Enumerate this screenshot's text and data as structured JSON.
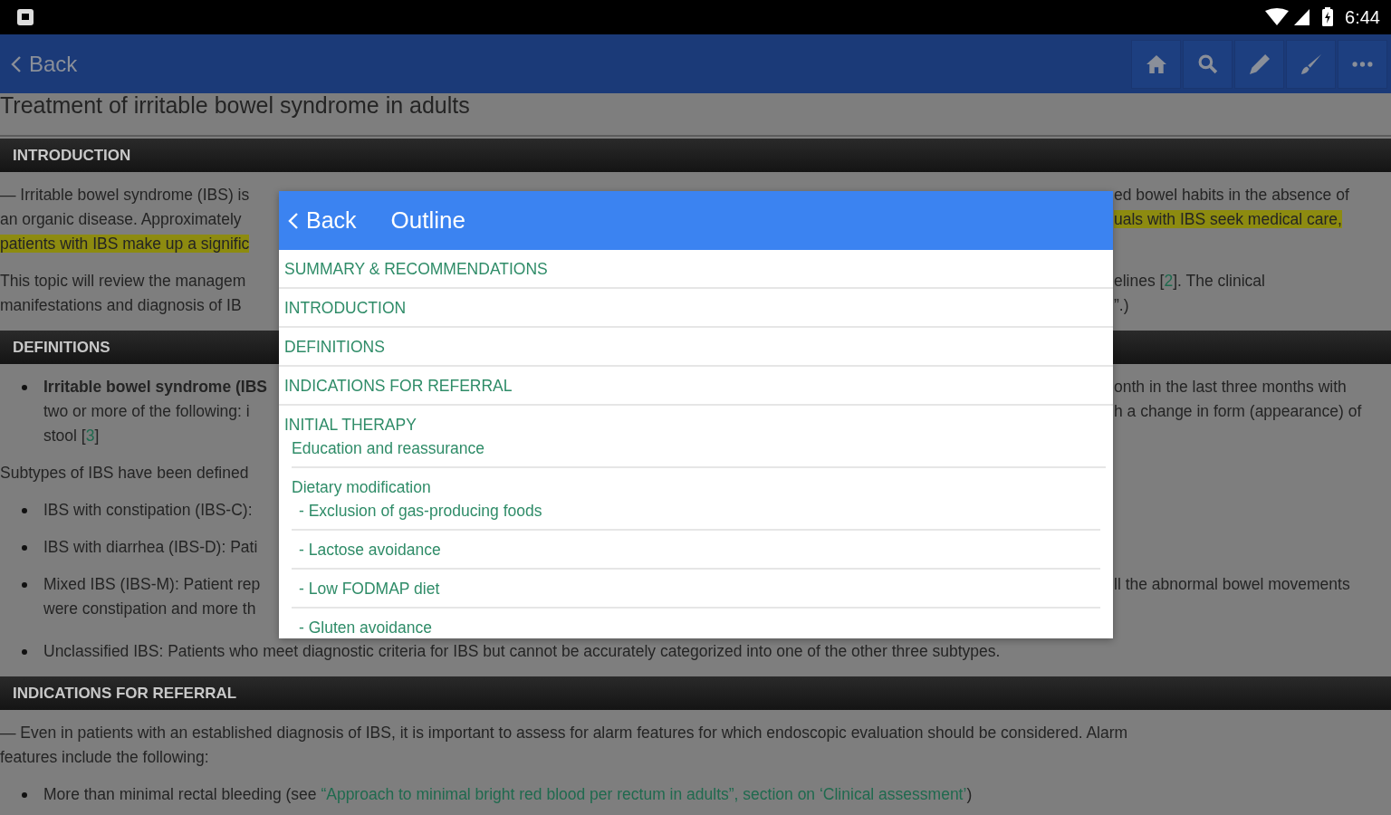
{
  "status_bar": {
    "time": "6:44"
  },
  "app_bar": {
    "back": "Back"
  },
  "title": "Treatment of irritable bowel syndrome in adults",
  "sections": [
    {
      "heading": "INTRODUCTION",
      "lines": [
        {
          "kind": "text",
          "left": [
            {
              "text": "— Irritable bowel syndrome (IBS) is",
              "kind": "plain"
            }
          ],
          "right": [
            {
              "text": "ed bowel habits in the absence of",
              "kind": "plain"
            }
          ]
        },
        {
          "kind": "text",
          "left": [
            {
              "text": "an organic disease. Approximately",
              "kind": "plain"
            }
          ],
          "right": [
            {
              "text": "uals with IBS seek medical care,",
              "kind": "highlight"
            }
          ]
        },
        {
          "kind": "text",
          "left": [
            {
              "text": "patients with IBS make up a signific",
              "kind": "highlight"
            }
          ]
        },
        {
          "kind": "gap"
        },
        {
          "kind": "text",
          "left": [
            {
              "text": "This topic will review the managem",
              "kind": "plain"
            }
          ],
          "right": [
            {
              "text": "elines [",
              "kind": "plain"
            },
            {
              "text": "2",
              "kind": "link"
            },
            {
              "text": "]. The clinical",
              "kind": "plain"
            }
          ]
        },
        {
          "kind": "text",
          "left": [
            {
              "text": "manifestations and diagnosis of IB",
              "kind": "plain"
            }
          ],
          "right": [
            {
              "text": "”.)",
              "kind": "plain"
            }
          ]
        }
      ]
    },
    {
      "heading": "DEFINITIONS",
      "lines": [
        {
          "kind": "bullet",
          "left": [
            {
              "text": "Irritable bowel syndrome (IBS",
              "kind": "bold"
            }
          ],
          "right": [
            {
              "text": "onth in the last three months with",
              "kind": "plain"
            }
          ]
        },
        {
          "kind": "cont",
          "left": [
            {
              "text": "two or more of the following: i",
              "kind": "plain"
            }
          ],
          "right": [
            {
              "text": "h a change in form (appearance) of",
              "kind": "plain"
            }
          ]
        },
        {
          "kind": "cont",
          "left": [
            {
              "text": "stool [",
              "kind": "plain"
            },
            {
              "text": "3",
              "kind": "link"
            },
            {
              "text": "]",
              "kind": "plain"
            }
          ]
        },
        {
          "kind": "gap"
        },
        {
          "kind": "text",
          "left": [
            {
              "text": "Subtypes of IBS have been defined",
              "kind": "plain"
            }
          ]
        },
        {
          "kind": "gap"
        },
        {
          "kind": "bullet",
          "left": [
            {
              "text": "IBS with constipation (IBS-C):",
              "kind": "plain"
            }
          ]
        },
        {
          "kind": "gap"
        },
        {
          "kind": "bullet",
          "left": [
            {
              "text": "IBS with diarrhea (IBS-D): Pati",
              "kind": "plain"
            }
          ]
        },
        {
          "kind": "gap"
        },
        {
          "kind": "bullet",
          "left": [
            {
              "text": "Mixed IBS (IBS-M): Patient rep",
              "kind": "plain"
            }
          ],
          "right": [
            {
              "text": "ll the abnormal bowel movements",
              "kind": "plain"
            }
          ]
        },
        {
          "kind": "cont",
          "left": [
            {
              "text": "were constipation and more th",
              "kind": "plain"
            }
          ]
        },
        {
          "kind": "gap"
        },
        {
          "kind": "full-bullet",
          "left": [
            {
              "text": "Unclassified IBS: Patients who meet diagnostic criteria for IBS but cannot be accurately categorized into one of the other three subtypes.",
              "kind": "plain"
            }
          ]
        }
      ]
    },
    {
      "heading": "INDICATIONS FOR REFERRAL",
      "lines": [
        {
          "kind": "full",
          "left": [
            {
              "text": "— Even in patients with an established diagnosis of IBS, it is important to assess for alarm features for which endoscopic evaluation should be considered. Alarm features include the following:",
              "kind": "plain"
            }
          ]
        },
        {
          "kind": "full-bullet",
          "left": [
            {
              "text": "More than minimal rectal bleeding (see ",
              "kind": "plain"
            },
            {
              "text": "“Approach to minimal bright red blood per rectum in adults”, section on ‘Clinical assessment’",
              "kind": "link"
            },
            {
              "text": ")",
              "kind": "plain"
            }
          ]
        }
      ]
    }
  ],
  "outline": {
    "back": "Back",
    "title": "Outline",
    "items": [
      {
        "label": "SUMMARY & RECOMMENDATIONS"
      },
      {
        "label": "INTRODUCTION"
      },
      {
        "label": "DEFINITIONS"
      },
      {
        "label": "INDICATIONS FOR REFERRAL"
      },
      {
        "label": "INITIAL THERAPY",
        "children": [
          {
            "label": "Education and reassurance"
          },
          {
            "label": "Dietary modification",
            "children": [
              {
                "label": "- Exclusion of gas-producing foods"
              },
              {
                "label": "- Lactose avoidance"
              },
              {
                "label": "- Low FODMAP diet"
              },
              {
                "label": "- Gluten avoidance"
              }
            ]
          }
        ]
      }
    ]
  }
}
